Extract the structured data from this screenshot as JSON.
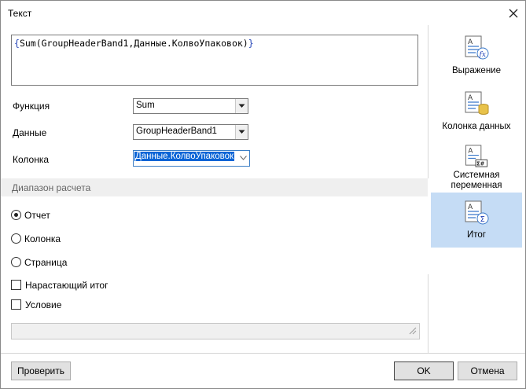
{
  "window": {
    "title": "Текст"
  },
  "expression": {
    "open_brace": "{",
    "text": "Sum(GroupHeaderBand1,Данные.КолвоУпаковок)",
    "close_brace": "}"
  },
  "form": {
    "function_label": "Функция",
    "function_value": "Sum",
    "data_label": "Данные",
    "data_value": "GroupHeaderBand1",
    "column_label": "Колонка",
    "column_value": "Данные.КолвоУпаковок"
  },
  "range": {
    "header": "Диапазон расчета",
    "options": [
      {
        "label": "Отчет",
        "selected": true
      },
      {
        "label": "Колонка",
        "selected": false
      },
      {
        "label": "Страница",
        "selected": false
      }
    ]
  },
  "checks": {
    "running_total": {
      "label": "Нарастающий итог",
      "checked": false
    },
    "condition": {
      "label": "Условие",
      "checked": false
    }
  },
  "sidebar": {
    "items": [
      {
        "label": "Выражение",
        "icon": "expression-icon",
        "selected": false
      },
      {
        "label": "Колонка данных",
        "icon": "data-column-icon",
        "selected": false
      },
      {
        "label": "Системная переменная",
        "icon": "system-variable-icon",
        "selected": false
      },
      {
        "label": "Итог",
        "icon": "total-icon",
        "selected": true
      }
    ]
  },
  "buttons": {
    "check": "Проверить",
    "ok": "OK",
    "cancel": "Отмена"
  },
  "colors": {
    "accent": "#0a64d6",
    "sidebar_selected": "#c5dcf5",
    "icon_blue": "#3a78c9",
    "icon_yellow": "#e8c24a"
  }
}
